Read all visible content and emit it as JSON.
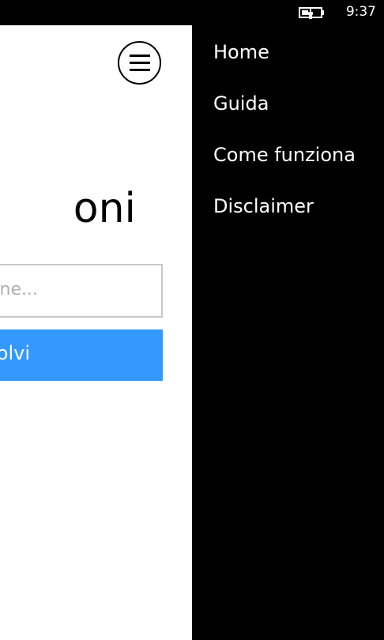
{
  "status_bar": {
    "time": "9:37",
    "battery_icon": "battery-charging-icon"
  },
  "main": {
    "title_fragment": "oni",
    "input_placeholder_fragment": "ne...",
    "button_label_fragment": "olvi",
    "menu_icon": "hamburger-menu-icon"
  },
  "nav": {
    "items": [
      {
        "label": "Home"
      },
      {
        "label": "Guida"
      },
      {
        "label": "Come funziona"
      },
      {
        "label": "Disclaimer"
      }
    ]
  },
  "colors": {
    "accent": "#3399ff",
    "background_dark": "#000000",
    "background_light": "#ffffff",
    "input_border": "#c8c8c8",
    "placeholder": "#b0b0b0"
  }
}
